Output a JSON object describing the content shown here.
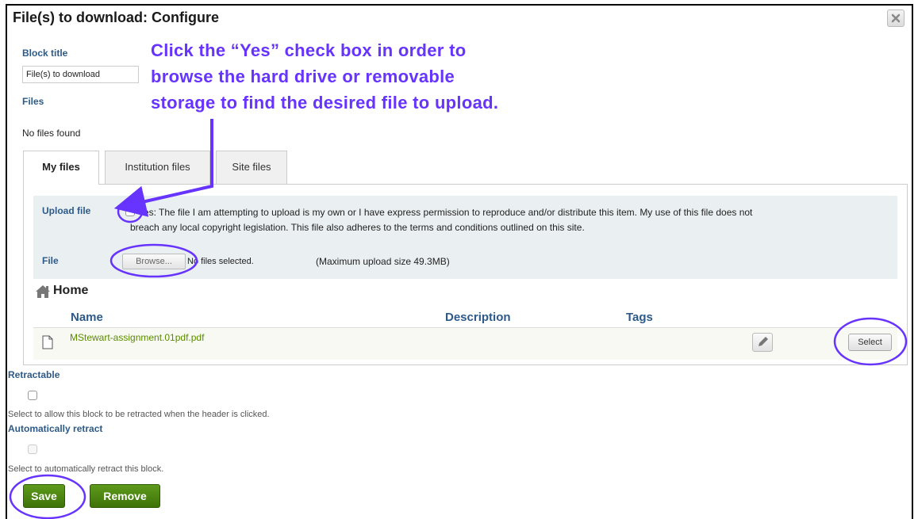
{
  "dialog": {
    "title": "File(s) to download: Configure",
    "close_icon": "close-icon"
  },
  "annotation": {
    "lines": [
      "Click the “Yes” check box in order to",
      "browse the hard drive or removable",
      "storage to find the desired file to upload."
    ],
    "color": "#6633ff"
  },
  "block_title": {
    "label": "Block title",
    "value": "File(s) to download"
  },
  "files": {
    "label": "Files",
    "empty_text": "No files found"
  },
  "tabs": [
    {
      "label": "My files",
      "active": true
    },
    {
      "label": "Institution files",
      "active": false
    },
    {
      "label": "Site files",
      "active": false
    }
  ],
  "upload": {
    "label": "Upload file",
    "permission_line1": "Yes: The file I am attempting to upload is my own or I have express permission to reproduce and/or distribute this item. My use of this file does not",
    "permission_line2": "breach any local copyright legislation. This file also adheres to the terms and conditions outlined on this site.",
    "file_label": "File",
    "browse_label": "Browse...",
    "no_file_text": "No files selected.",
    "max_size": "(Maximum upload size 49.3MB)"
  },
  "browser": {
    "home_label": "Home",
    "home_icon": "home-icon",
    "columns": {
      "name": "Name",
      "description": "Description",
      "tags": "Tags"
    },
    "rows": [
      {
        "name": "MStewart-assignment.01pdf.pdf",
        "description": "",
        "tags": "",
        "select_label": "Select",
        "file_icon": "file-icon",
        "edit_icon": "pencil-icon"
      }
    ]
  },
  "retractable": {
    "label": "Retractable",
    "help": "Select to allow this block to be retracted when the header is clicked."
  },
  "auto_retract": {
    "label": "Automatically retract",
    "help": "Select to automatically retract this block."
  },
  "actions": {
    "save_label": "Save",
    "remove_label": "Remove",
    "button_color": "#4a8410"
  }
}
